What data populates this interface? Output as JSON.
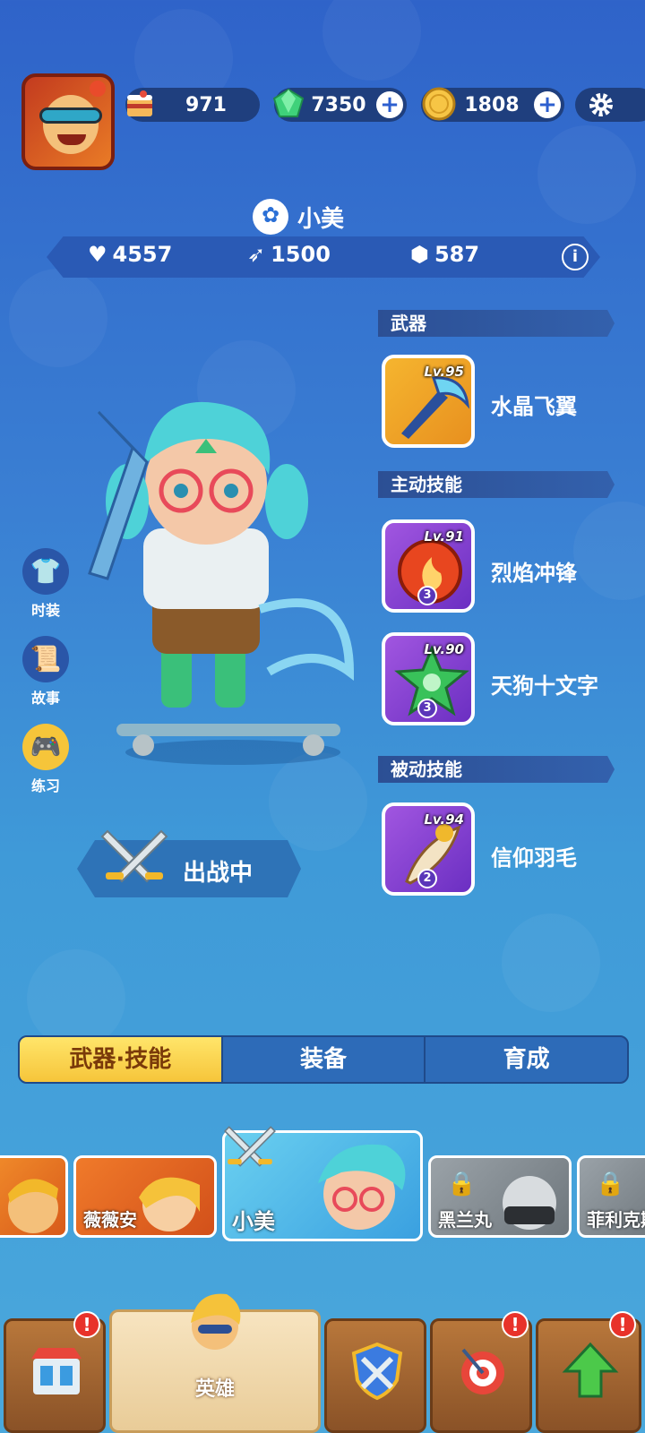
{
  "resources": {
    "cake": {
      "icon": "cake-icon",
      "value": "971"
    },
    "gems": {
      "icon": "gem-icon",
      "value": "7350"
    },
    "coins": {
      "icon": "coin-icon",
      "value": "1808"
    }
  },
  "hero": {
    "name": "小美",
    "stats": {
      "hp": "4557",
      "attack": "1500",
      "defense": "587"
    }
  },
  "sections": {
    "weapon": "武器",
    "active_skill": "主动技能",
    "passive_skill": "被动技能"
  },
  "weapon": {
    "level": "Lv.95",
    "name": "水晶飞翼"
  },
  "active_skills": [
    {
      "level": "Lv.91",
      "name": "烈焰冲锋",
      "count": "3"
    },
    {
      "level": "Lv.90",
      "name": "天狗十文字",
      "count": "3"
    }
  ],
  "passive_skills": [
    {
      "level": "Lv.94",
      "name": "信仰羽毛",
      "count": "2"
    }
  ],
  "side_menu": {
    "fashion": "时装",
    "story": "故事",
    "practice": "练习"
  },
  "battle_status": "出战中",
  "tabs": [
    "武器·技能",
    "装备",
    "育成"
  ],
  "roster": [
    "薇薇安",
    "小美",
    "黑兰丸",
    "菲利克斯"
  ],
  "bottom_nav": {
    "heroes": "英雄"
  },
  "alert_mark": "!",
  "colors": {
    "accent_yellow": "#f6c53a",
    "bg_blue": "#3a7fd3",
    "alert_red": "#e8322a"
  }
}
